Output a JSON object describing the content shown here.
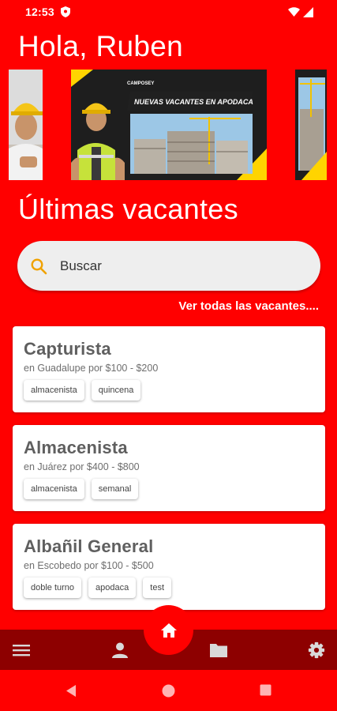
{
  "status": {
    "time": "12:53"
  },
  "header": {
    "greeting": "Hola, Ruben"
  },
  "banner": {
    "brand": "CAMPOSEY",
    "headline": "NUEVAS VACANTES EN APODACA"
  },
  "section": {
    "title": "Últimas vacantes"
  },
  "search": {
    "placeholder": "Buscar"
  },
  "see_all": {
    "label": "Ver todas las vacantes...."
  },
  "jobs": [
    {
      "title": "Capturista",
      "subtitle": "en Guadalupe por $100 - $200",
      "tags": [
        "almacenista",
        "quincena"
      ]
    },
    {
      "title": "Almacenista",
      "subtitle": "en Juárez por $400 - $800",
      "tags": [
        "almacenista",
        "semanal"
      ]
    },
    {
      "title": "Albañil General",
      "subtitle": "en Escobedo por $100 - $500",
      "tags": [
        "doble turno",
        "apodaca",
        "test"
      ]
    }
  ],
  "nav": {
    "icons": [
      "menu-icon",
      "person-icon",
      "folder-icon",
      "home-icon",
      "settings-icon"
    ]
  },
  "colors": {
    "primary": "#ff0000",
    "nav_bar": "#8d0000",
    "banner_accent": "#ffd400"
  }
}
